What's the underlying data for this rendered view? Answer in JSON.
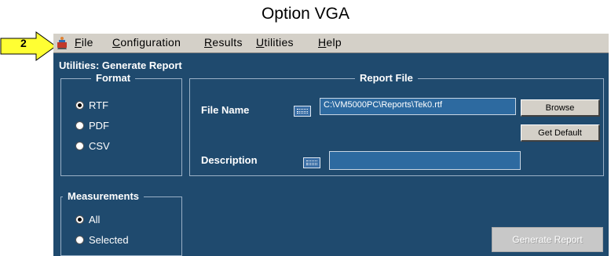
{
  "caption": "Option VGA",
  "callout": {
    "number": "2"
  },
  "menubar": {
    "items": [
      {
        "mnemonic": "F",
        "rest": "ile"
      },
      {
        "mnemonic": "C",
        "rest": "onfiguration"
      },
      {
        "mnemonic": "R",
        "rest": "esults"
      },
      {
        "mnemonic": "U",
        "rest": "tilities"
      },
      {
        "mnemonic": "H",
        "rest": "elp"
      }
    ]
  },
  "panel": {
    "title": "Utilities: Generate Report",
    "format": {
      "label": "Format",
      "options": [
        "RTF",
        "PDF",
        "CSV"
      ],
      "selected": "RTF"
    },
    "measurements": {
      "label": "Measurements",
      "options": [
        "All",
        "Selected"
      ],
      "selected": "All"
    },
    "report_file": {
      "label": "Report File",
      "file_name_label": "File Name",
      "file_name_value": "C:\\VM5000PC\\Reports\\Tek0.rtf",
      "description_label": "Description",
      "description_value": "",
      "browse_label": "Browse",
      "default_label": "Get Default"
    },
    "generate_label": "Generate Report"
  },
  "colors": {
    "panel_bg": "#1f4a6e",
    "menubar_bg": "#d4d0c8",
    "callout_fill": "#ffff33"
  }
}
